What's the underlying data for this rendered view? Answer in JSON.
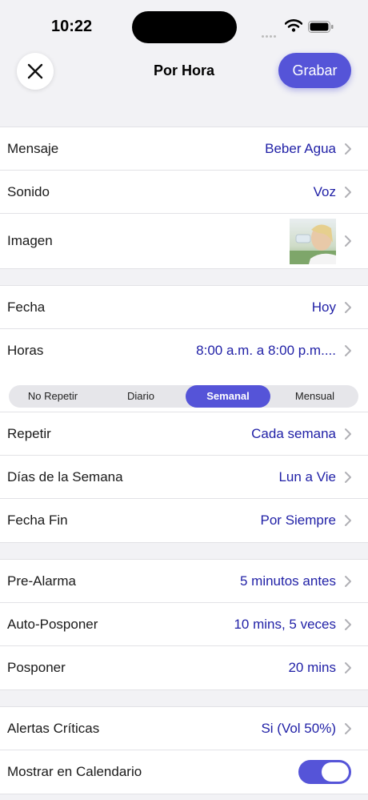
{
  "status": {
    "time": "10:22"
  },
  "nav": {
    "title": "Por Hora",
    "save_label": "Grabar"
  },
  "group1": [
    {
      "label": "Mensaje",
      "value": "Beber Agua"
    },
    {
      "label": "Sonido",
      "value": "Voz"
    },
    {
      "label": "Imagen",
      "value": ""
    }
  ],
  "group2": [
    {
      "label": "Fecha",
      "value": "Hoy"
    },
    {
      "label": "Horas",
      "value": "8:00 a.m. a 8:00 p.m...."
    }
  ],
  "segments": {
    "items": [
      "No Repetir",
      "Diario",
      "Semanal",
      "Mensual"
    ],
    "selected": "Semanal"
  },
  "group3": [
    {
      "label": "Repetir",
      "value": "Cada semana"
    },
    {
      "label": "Días de la Semana",
      "value": "Lun a Vie"
    },
    {
      "label": "Fecha Fin",
      "value": "Por Siempre"
    }
  ],
  "group4": [
    {
      "label": "Pre-Alarma",
      "value": "5 minutos antes"
    },
    {
      "label": "Auto-Posponer",
      "value": "10 mins, 5 veces"
    },
    {
      "label": "Posponer",
      "value": "20 mins"
    }
  ],
  "group5": [
    {
      "label": "Alertas Críticas",
      "value": "Si (Vol 50%)"
    },
    {
      "label": "Mostrar en Calendario",
      "toggle_on": true
    }
  ],
  "colors": {
    "accent": "#5554d8",
    "value_text": "#1f1fa6",
    "background": "#f2f2f5"
  }
}
